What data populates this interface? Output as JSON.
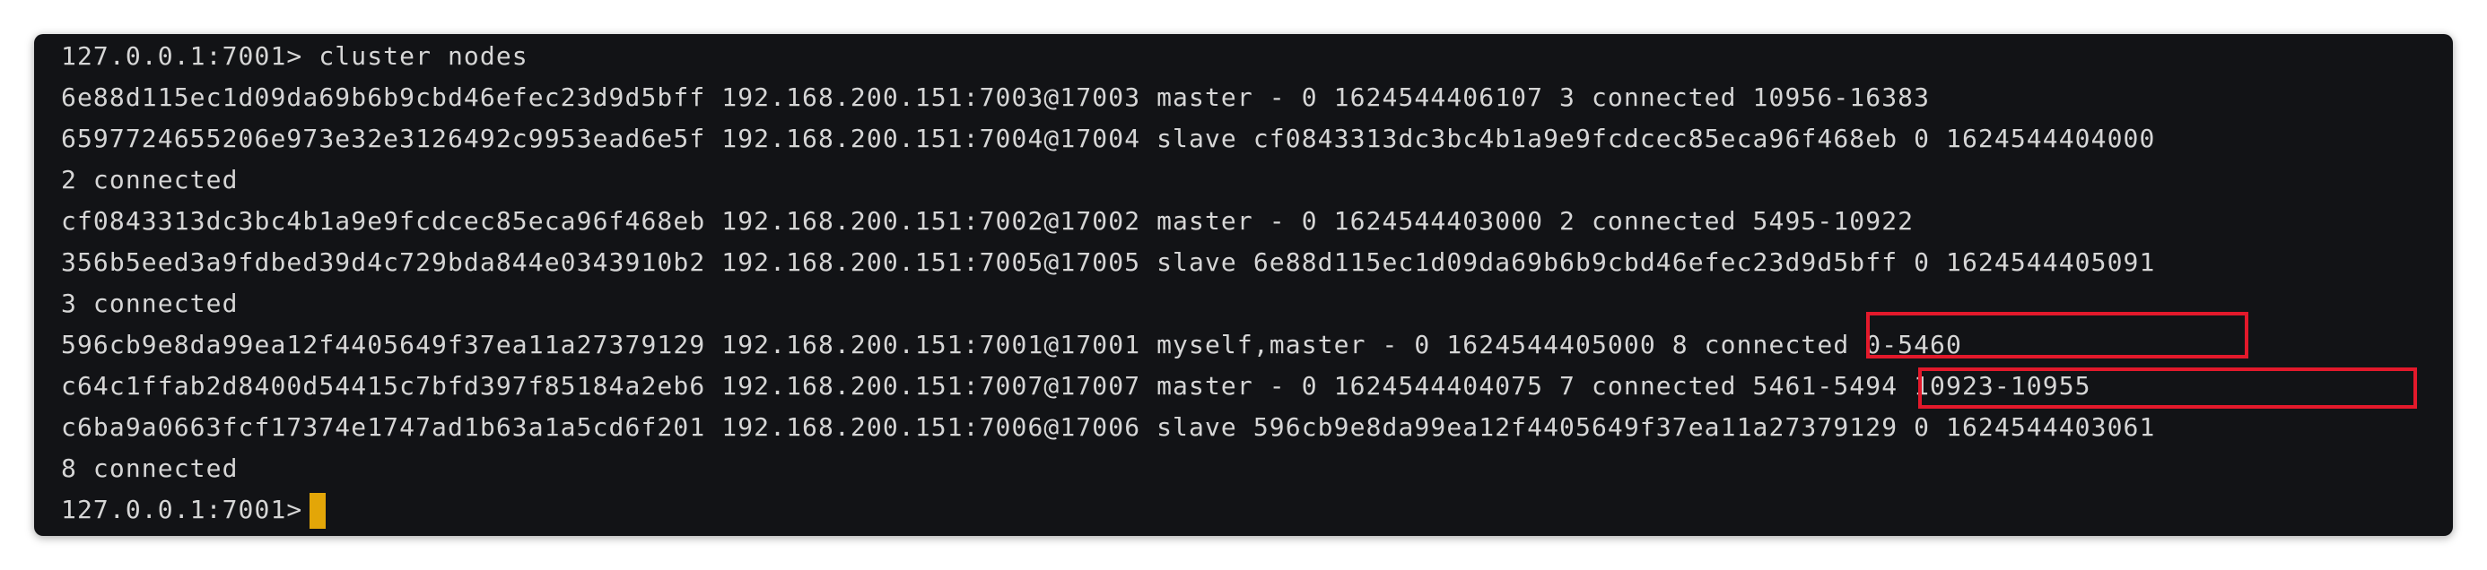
{
  "terminal": {
    "prompt": "127.0.0.1:7001>",
    "command": "cluster nodes",
    "lines": [
      "127.0.0.1:7001> cluster nodes",
      "6e88d115ec1d09da69b6b9cbd46efec23d9d5bff 192.168.200.151:7003@17003 master - 0 1624544406107 3 connected 10956-16383",
      "6597724655206e973e32e3126492c9953ead6e5f 192.168.200.151:7004@17004 slave cf0843313dc3bc4b1a9e9fcdcec85eca96f468eb 0 1624544404000",
      "2 connected",
      "cf0843313dc3bc4b1a9e9fcdcec85eca96f468eb 192.168.200.151:7002@17002 master - 0 1624544403000 2 connected 5495-10922",
      "356b5eed3a9fdbed39d4c729bda844e0343910b2 192.168.200.151:7005@17005 slave 6e88d115ec1d09da69b6b9cbd46efec23d9d5bff 0 1624544405091",
      "3 connected",
      "596cb9e8da99ea12f4405649f37ea11a27379129 192.168.200.151:7001@17001 myself,master - 0 1624544405000 8 connected 0-5460",
      "c64c1ffab2d8400d54415c7bfd397f85184a2eb6 192.168.200.151:7007@17007 master - 0 1624544404075 7 connected 5461-5494 10923-10955",
      "c6ba9a0663fcf17374e1747ad1b63a1a5cd6f201 192.168.200.151:7006@17006 slave 596cb9e8da99ea12f4405649f37ea11a27379129 0 1624544403061",
      "8 connected"
    ],
    "final_prompt": "127.0.0.1:7001>"
  },
  "highlights": [
    "connected 0-5460",
    "5461-5494 10923-10955"
  ],
  "colors": {
    "terminal_bg": "#121316",
    "text": "#d6d6d6",
    "highlight_border": "#e3192b",
    "cursor": "#e3a608"
  }
}
